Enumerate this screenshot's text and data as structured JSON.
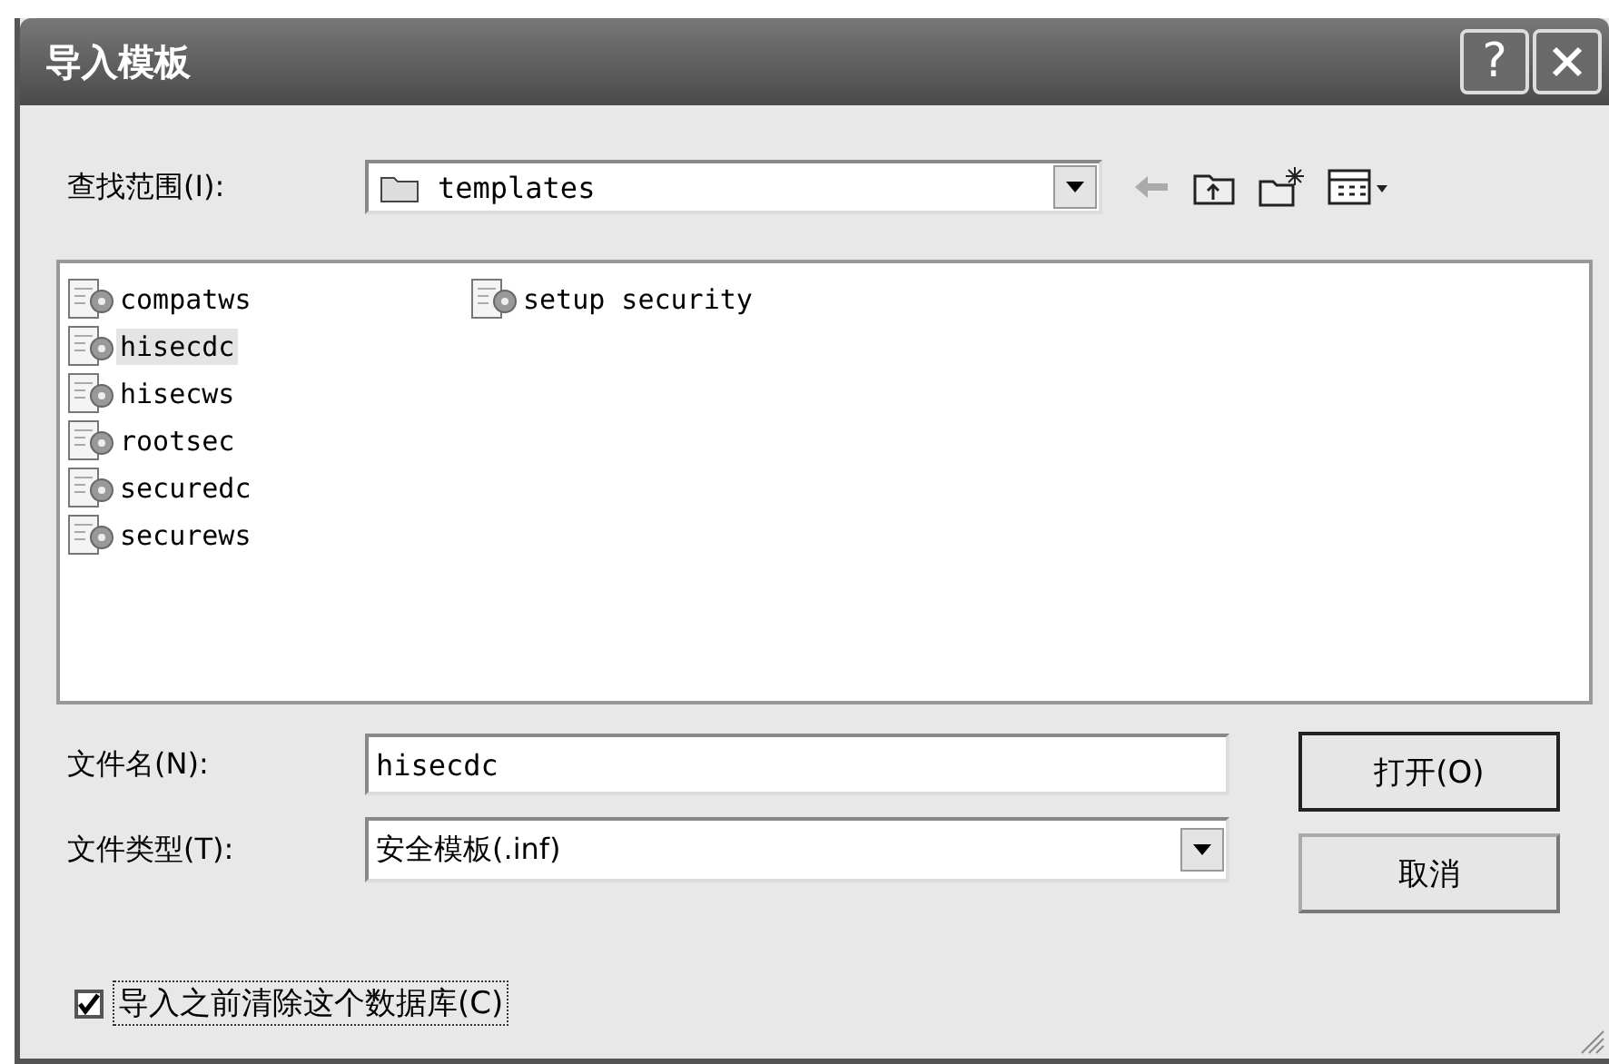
{
  "window": {
    "title": "导入模板",
    "help": "?"
  },
  "look_in": {
    "label": "查找范围(I):",
    "value": "templates"
  },
  "files": [
    {
      "name": "compatws",
      "selected": false
    },
    {
      "name": "hisecdc",
      "selected": true
    },
    {
      "name": "hisecws",
      "selected": false
    },
    {
      "name": "rootsec",
      "selected": false
    },
    {
      "name": "securedc",
      "selected": false
    },
    {
      "name": "securews",
      "selected": false
    },
    {
      "name": "setup security",
      "selected": false
    }
  ],
  "file_name": {
    "label": "文件名(N):",
    "value": "hisecdc"
  },
  "file_type": {
    "label": "文件类型(T):",
    "value": "安全模板(.inf)"
  },
  "buttons": [
    {
      "label": "打开(O)",
      "kind": "default"
    },
    {
      "label": "取消",
      "kind": "normal"
    }
  ],
  "clear_db": {
    "label": "导入之前清除这个数据库(C)",
    "checked": true
  }
}
